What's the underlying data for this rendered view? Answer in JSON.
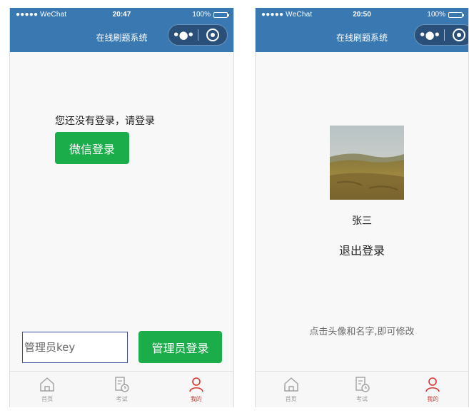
{
  "status_bar": [
    {
      "carrier": "●●●●● WeChat",
      "time": "20:47",
      "battery": "100%"
    },
    {
      "carrier": "●●●●● WeChat",
      "time": "20:50",
      "battery": "100%"
    }
  ],
  "nav_title": "在线刷题系统",
  "capsule": {
    "more": "•●•"
  },
  "login_screen": {
    "prompt": "您还没有登录，请登录",
    "wechat_login_button": "微信登录",
    "admin_key_placeholder": "管理员key",
    "admin_login_button": "管理员登录"
  },
  "profile_screen": {
    "username": "张三",
    "logout": "退出登录",
    "hint": "点击头像和名字,即可修改"
  },
  "tabs": [
    {
      "label": "首页",
      "icon": "home-icon",
      "active": false
    },
    {
      "label": "考试",
      "icon": "exam-icon",
      "active": false
    },
    {
      "label": "我的",
      "icon": "profile-icon",
      "active": true
    }
  ],
  "colors": {
    "nav": "#3a78b2",
    "green": "#1aad4a",
    "active_tab": "#d9332e"
  }
}
